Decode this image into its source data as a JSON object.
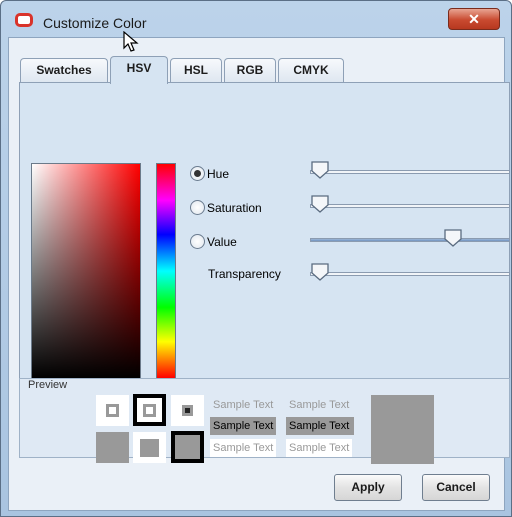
{
  "window": {
    "title": "Customize Color",
    "close_glyph": "✕"
  },
  "tabs": [
    {
      "label": "Swatches",
      "active": false
    },
    {
      "label": "HSV",
      "active": true
    },
    {
      "label": "HSL",
      "active": false
    },
    {
      "label": "RGB",
      "active": false
    },
    {
      "label": "CMYK",
      "active": false
    }
  ],
  "hsv": {
    "radios": [
      {
        "label": "Hue",
        "checked": true
      },
      {
        "label": "Saturation",
        "checked": false
      },
      {
        "label": "Value",
        "checked": false
      }
    ],
    "transparency_label": "Transparency",
    "slider_levels": {
      "hue": 0.0,
      "saturation": 0.0,
      "value": 0.74,
      "transparency": 0.0
    }
  },
  "preview": {
    "label": "Preview",
    "sample_text": "Sample Text"
  },
  "buttons": {
    "apply": "Apply",
    "cancel": "Cancel"
  },
  "colors": {
    "selected": "#999999",
    "accent_red": "#d9332a"
  }
}
